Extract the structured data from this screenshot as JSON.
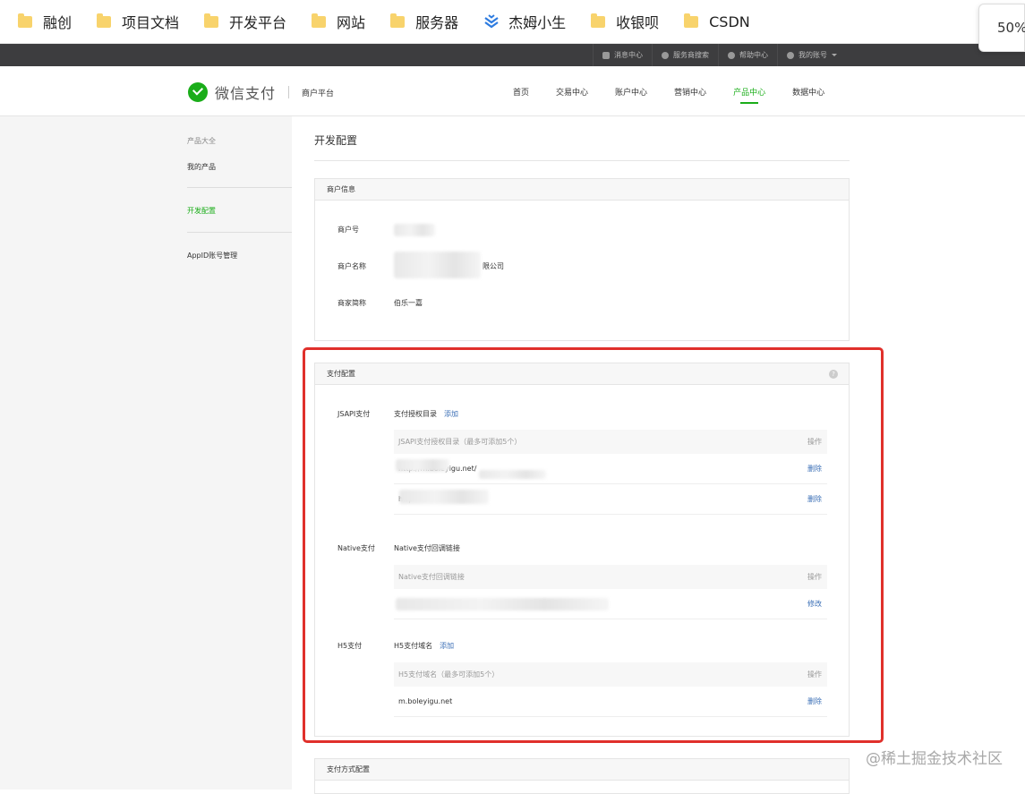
{
  "bookmarks": {
    "items": [
      {
        "label": "融创",
        "icon": "folder-icon"
      },
      {
        "label": "项目文档",
        "icon": "folder-icon"
      },
      {
        "label": "开发平台",
        "icon": "folder-icon"
      },
      {
        "label": "网站",
        "icon": "folder-icon"
      },
      {
        "label": "服务器",
        "icon": "folder-icon"
      },
      {
        "label": "杰姆小生",
        "icon": "jm-icon"
      },
      {
        "label": "收银呗",
        "icon": "folder-icon"
      },
      {
        "label": "CSDN",
        "icon": "folder-icon"
      }
    ],
    "zoom": "50%"
  },
  "topbar": {
    "links": [
      "消息中心",
      "服务商搜索",
      "帮助中心",
      "我的账号"
    ]
  },
  "header": {
    "logo_text": "微信支付",
    "sub_title": "商户平台",
    "nav": [
      "首页",
      "交易中心",
      "账户中心",
      "营销中心",
      "产品中心",
      "数据中心"
    ],
    "active_nav": "产品中心"
  },
  "sidebar": {
    "group_title": "产品大全",
    "items": [
      "我的产品",
      "开发配置",
      "AppID账号管理"
    ],
    "active": "开发配置"
  },
  "main": {
    "title": "开发配置",
    "merchant_panel": {
      "head": "商户信息",
      "rows": [
        {
          "label": "商户号",
          "value": ""
        },
        {
          "label": "商户名称",
          "value": "限公司"
        },
        {
          "label": "商家简称",
          "value": "伯乐一嘉"
        }
      ]
    },
    "pay_panel": {
      "head": "支付配置",
      "help": "?",
      "jsapi": {
        "label": "JSAPI支付",
        "title": "支付授权目录",
        "add": "添加",
        "col_main": "JSAPI支付授权目录（最多可添加5个）",
        "col_op": "操作",
        "rows": [
          {
            "value": "http://m.boleyigu.net/",
            "op": "删除"
          },
          {
            "value": "http",
            "op": "删除"
          }
        ]
      },
      "native": {
        "label": "Native支付",
        "title": "Native支付回调链接",
        "col_main": "Native支付回调链接",
        "col_op": "操作",
        "rows": [
          {
            "value": "",
            "op": "修改"
          }
        ]
      },
      "h5": {
        "label": "H5支付",
        "title": "H5支付域名",
        "add": "添加",
        "col_main": "H5支付域名（最多可添加5个）",
        "col_op": "操作",
        "rows": [
          {
            "value": "m.boleyigu.net",
            "op": "删除"
          }
        ]
      }
    },
    "method_panel": {
      "head": "支付方式配置"
    }
  },
  "watermark": "@稀土掘金技术社区",
  "colors": {
    "brand_green": "#1aad19",
    "link_blue": "#3b6fb6",
    "highlight_red": "#e0302b",
    "topbar": "#3d3d3f"
  }
}
